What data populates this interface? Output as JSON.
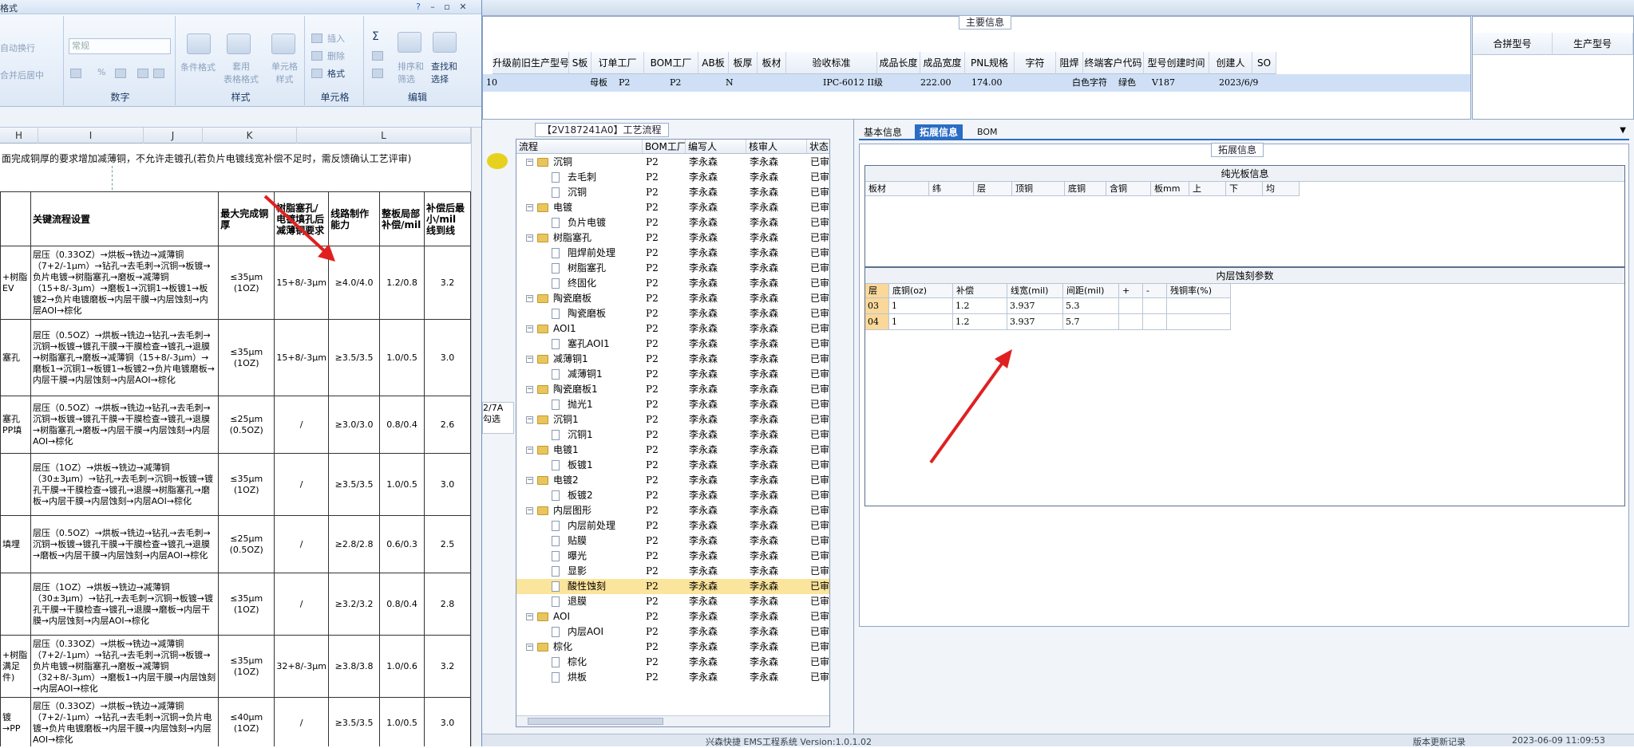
{
  "excel": {
    "title": "格式",
    "ribbon": {
      "alignment": {
        "wrap": "自动换行",
        "merge": "合并后居中"
      },
      "number": {
        "format_value": "常规",
        "percent": "%",
        "label": "数字"
      },
      "styles": {
        "cond_format": "条件格式",
        "table_format": "套用\n表格格式",
        "cell_styles": "单元格\n样式",
        "label": "样式"
      },
      "cells": {
        "insert": "插入",
        "delete": "删除",
        "format": "格式",
        "label": "单元格"
      },
      "editing": {
        "sort": "排序和\n筛选",
        "find": "查找和\n选择",
        "label": "编辑"
      }
    },
    "columns": [
      "H",
      "I",
      "J",
      "K",
      "L"
    ],
    "note": "面完成铜厚的要求增加减薄铜，不允许走镀孔(若负片电镀线宽补偿不足时，需反馈确认工艺评审)",
    "table_headers": {
      "col1": "关键流程设置",
      "col2": "最大完成铜厚",
      "col3": "树脂塞孔/电镀填孔后减薄铜要求",
      "col4": "线路制作能力",
      "col5": "整板局部补偿/mil",
      "col6": "补偿后最小/mil",
      "col6b": "线到线"
    },
    "rows": [
      {
        "left": "+树脂\nEV",
        "flow": "层压（0.33OZ）→烘板→铣边→减薄铜（7+2/-1μm）→钻孔→去毛刺→沉铜→板镀→负片电镀→树脂塞孔→磨板→减薄铜（15+8/-3μm）→磨板1→沉铜1→板镀1→板镀2→负片电镀磨板→内层干膜→内层蚀刻→内层AOI→棕化",
        "thick": "≤35μm\n(1OZ)",
        "req": "15+8/-3μm",
        "cap": "≥4.0/4.0",
        "comp": "1.2/0.8",
        "min": "3.2"
      },
      {
        "left": "塞孔",
        "flow": "层压（0.5OZ）→烘板→铣边→钻孔→去毛刺→沉铜→板镀→镀孔干膜→干膜检查→镀孔→退膜→树脂塞孔→磨板→减薄铜（15+8/-3μm）→磨板1→沉铜1→板镀1→板镀2→负片电镀磨板→内层干膜→内层蚀刻→内层AOI→棕化",
        "thick": "≤35μm\n(1OZ)",
        "req": "15+8/-3μm",
        "cap": "≥3.5/3.5",
        "comp": "1.0/0.5",
        "min": "3.0"
      },
      {
        "left": "塞孔\nPP填",
        "flow": "层压（0.5OZ）→烘板→铣边→钻孔→去毛刺→沉铜→板镀→镀孔干膜→干膜检查→镀孔→退膜→树脂塞孔→磨板→内层干膜→内层蚀刻→内层AOI→棕化",
        "thick": "≤25μm\n(0.5OZ)",
        "req": "/",
        "cap": "≥3.0/3.0",
        "comp": "0.8/0.4",
        "min": "2.6"
      },
      {
        "left": "",
        "flow": "层压（1OZ）→烘板→铣边→减薄铜（30±3μm）→钻孔→去毛刺→沉铜→板镀→镀孔干膜→干膜检查→镀孔→退膜→树脂塞孔→磨板→内层干膜→内层蚀刻→内层AOI→棕化",
        "thick": "≤35μm\n(1OZ)",
        "req": "/",
        "cap": "≥3.5/3.5",
        "comp": "1.0/0.5",
        "min": "3.0"
      },
      {
        "left": "填埋",
        "flow": "层压（0.5OZ）→烘板→铣边→钻孔→去毛刺→沉铜→板镀→镀孔干膜→干膜检查→镀孔→退膜→磨板→内层干膜→内层蚀刻→内层AOI→棕化",
        "thick": "≤25μm\n(0.5OZ)",
        "req": "/",
        "cap": "≥2.8/2.8",
        "comp": "0.6/0.3",
        "min": "2.5"
      },
      {
        "left": "",
        "flow": "层压（1OZ）→烘板→铣边→减薄铜（30±3μm）→钻孔→去毛刺→沉铜→板镀→镀孔干膜→干膜检查→镀孔→退膜→磨板→内层干膜→内层蚀刻→内层AOI→棕化",
        "thick": "≤35μm\n(1OZ)",
        "req": "/",
        "cap": "≥3.2/3.2",
        "comp": "0.8/0.4",
        "min": "2.8"
      },
      {
        "left": "+树脂\n满足\n件)",
        "flow": "层压（0.33OZ）→烘板→铣边→减薄铜（7+2/-1μm）→钻孔→去毛刺→沉铜→板镀→负片电镀→树脂塞孔→磨板→减薄铜（32+8/-3μm）→磨板1→内层干膜→内层蚀刻→内层AOI→棕化",
        "thick": "≤35μm\n(1OZ)",
        "req": "32+8/-3μm",
        "cap": "≥3.8/3.8",
        "comp": "1.0/0.6",
        "min": "3.2"
      },
      {
        "left": "镀→PP",
        "flow": "层压（0.33OZ）→烘板→铣边→减薄铜（7+2/-1μm）→钻孔→去毛刺→沉铜→负片电镀→负片电镀磨板→内层干膜→内层蚀刻→内层AOI→棕化",
        "thick": "≤40μm\n(1OZ)",
        "req": "/",
        "cap": "≥3.5/3.5",
        "comp": "1.0/0.5",
        "min": "3.0"
      }
    ]
  },
  "app": {
    "main_info_title": "主要信息",
    "main_headers": [
      "升级前旧生产型号",
      "S板",
      "订单工厂",
      "BOM工厂",
      "AB板",
      "板厚",
      "板材",
      "验收标准",
      "成品长度",
      "成品宽度",
      "PNL规格",
      "字符",
      "阻焊",
      "终端客户代码",
      "型号创建时间",
      "创建人",
      "SO"
    ],
    "main_row": {
      "c0": "10",
      "sboard": "母板",
      "order": "P2",
      "bom": "P2",
      "ab": "N",
      "std": "IPC-6012 II级",
      "len": "222.00",
      "wid": "174.00",
      "char": "白色字符",
      "mask": "绿色",
      "cust": "V187",
      "time": "2023/6/9"
    },
    "right_headers": [
      "合拼型号",
      "生产型号"
    ],
    "process_title": "【2V187241A0】工艺流程",
    "tree_headers": [
      "流程",
      "BOM工厂",
      "编写人",
      "核审人",
      "状态"
    ],
    "left_stub": [
      "2/7A",
      "勾选"
    ],
    "tree": [
      {
        "level": 1,
        "name": "沉铜",
        "type": "folder"
      },
      {
        "level": 2,
        "name": "去毛刺",
        "type": "doc"
      },
      {
        "level": 2,
        "name": "沉铜",
        "type": "doc"
      },
      {
        "level": 1,
        "name": "电镀",
        "type": "folder"
      },
      {
        "level": 2,
        "name": "负片电镀",
        "type": "doc"
      },
      {
        "level": 1,
        "name": "树脂塞孔",
        "type": "folder"
      },
      {
        "level": 2,
        "name": "阻焊前处理",
        "type": "doc"
      },
      {
        "level": 2,
        "name": "树脂塞孔",
        "type": "doc"
      },
      {
        "level": 2,
        "name": "终固化",
        "type": "doc"
      },
      {
        "level": 1,
        "name": "陶瓷磨板",
        "type": "folder"
      },
      {
        "level": 2,
        "name": "陶瓷磨板",
        "type": "doc"
      },
      {
        "level": 1,
        "name": "AOI1",
        "type": "folder"
      },
      {
        "level": 2,
        "name": "塞孔AOI1",
        "type": "doc"
      },
      {
        "level": 1,
        "name": "减薄铜1",
        "type": "folder"
      },
      {
        "level": 2,
        "name": "减薄铜1",
        "type": "doc"
      },
      {
        "level": 1,
        "name": "陶瓷磨板1",
        "type": "folder"
      },
      {
        "level": 2,
        "name": "抛光1",
        "type": "doc"
      },
      {
        "level": 1,
        "name": "沉铜1",
        "type": "folder"
      },
      {
        "level": 2,
        "name": "沉铜1",
        "type": "doc"
      },
      {
        "level": 1,
        "name": "电镀1",
        "type": "folder"
      },
      {
        "level": 2,
        "name": "板镀1",
        "type": "doc"
      },
      {
        "level": 1,
        "name": "电镀2",
        "type": "folder"
      },
      {
        "level": 2,
        "name": "板镀2",
        "type": "doc"
      },
      {
        "level": 1,
        "name": "内层图形",
        "type": "folder"
      },
      {
        "level": 2,
        "name": "内层前处理",
        "type": "doc"
      },
      {
        "level": 2,
        "name": "贴膜",
        "type": "doc"
      },
      {
        "level": 2,
        "name": "曝光",
        "type": "doc"
      },
      {
        "level": 2,
        "name": "显影",
        "type": "doc"
      },
      {
        "level": 2,
        "name": "酸性蚀刻",
        "type": "doc",
        "selected": true
      },
      {
        "level": 2,
        "name": "退膜",
        "type": "doc"
      },
      {
        "level": 1,
        "name": "AOI",
        "type": "folder"
      },
      {
        "level": 2,
        "name": "内层AOI",
        "type": "doc"
      },
      {
        "level": 1,
        "name": "棕化",
        "type": "folder"
      },
      {
        "level": 2,
        "name": "棕化",
        "type": "doc"
      },
      {
        "level": 2,
        "name": "烘板",
        "type": "doc"
      }
    ],
    "tree_common": {
      "factory": "P2",
      "writer": "李永森",
      "reviewer": "李永森",
      "status": "已审核"
    },
    "tabs": [
      "基本信息",
      "拓展信息",
      "BOM"
    ],
    "ext_title": "拓展信息",
    "core_title": "纯光板信息",
    "core_headers": [
      "板材",
      "纬",
      "层",
      "顶铜",
      "底铜",
      "含铜",
      "板mm",
      "上",
      "下",
      "均"
    ],
    "etch_title": "内层蚀刻参数",
    "etch_headers": [
      "层",
      "底铜(oz)",
      "补偿",
      "线宽(mil)",
      "间距(mil)",
      "+",
      "-",
      "残铜率(%)"
    ],
    "etch_rows": [
      [
        "03",
        "1",
        "1.2",
        "3.937",
        "5.3",
        "",
        "",
        ""
      ],
      [
        "04",
        "1",
        "1.2",
        "3.937",
        "5.7",
        "",
        "",
        ""
      ]
    ],
    "status_bar": {
      "center": "兴森快捷 EMS工程系统 Version:1.0.1.02",
      "right1": "版本更新记录",
      "time": "2023-06-09 11:09:53"
    }
  },
  "colors": {
    "selected_row": "#fbe49b",
    "tab_active": "#2b6cc4",
    "arrow": "#e02020"
  }
}
